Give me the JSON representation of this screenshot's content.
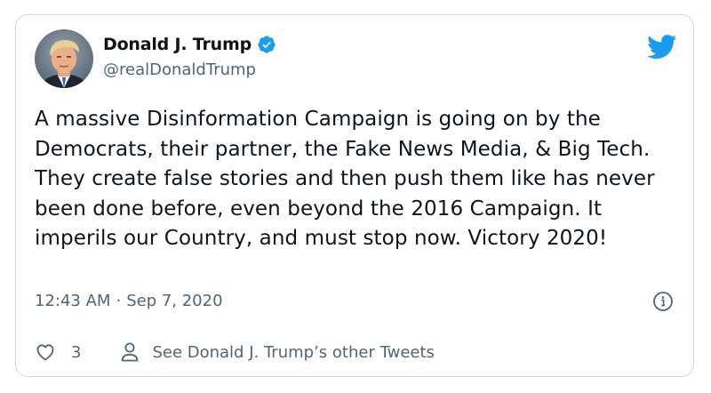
{
  "author": {
    "display_name": "Donald J. Trump",
    "handle": "@realDonaldTrump",
    "verified": true
  },
  "tweet": {
    "text": "A massive Disinformation Campaign is going on by the Democrats, their partner, the Fake News Media, & Big Tech. They create false stories and then push them like has never been done before, even beyond the 2016 Campaign. It imperils our Country, and must stop now. Victory 2020!",
    "time": "12:43 AM",
    "separator": "·",
    "date": "Sep 7, 2020"
  },
  "actions": {
    "like_count": "3",
    "other_tweets_label": "See Donald J. Trump’s other Tweets"
  },
  "icons": {
    "brand": "twitter-bird-icon",
    "verified": "verified-badge-icon",
    "info": "info-icon",
    "like": "heart-icon",
    "profile": "person-icon"
  },
  "colors": {
    "brand_blue": "#1d9bf0",
    "text_primary": "#0f1419",
    "text_secondary": "#536471",
    "border": "#cfd9de"
  }
}
